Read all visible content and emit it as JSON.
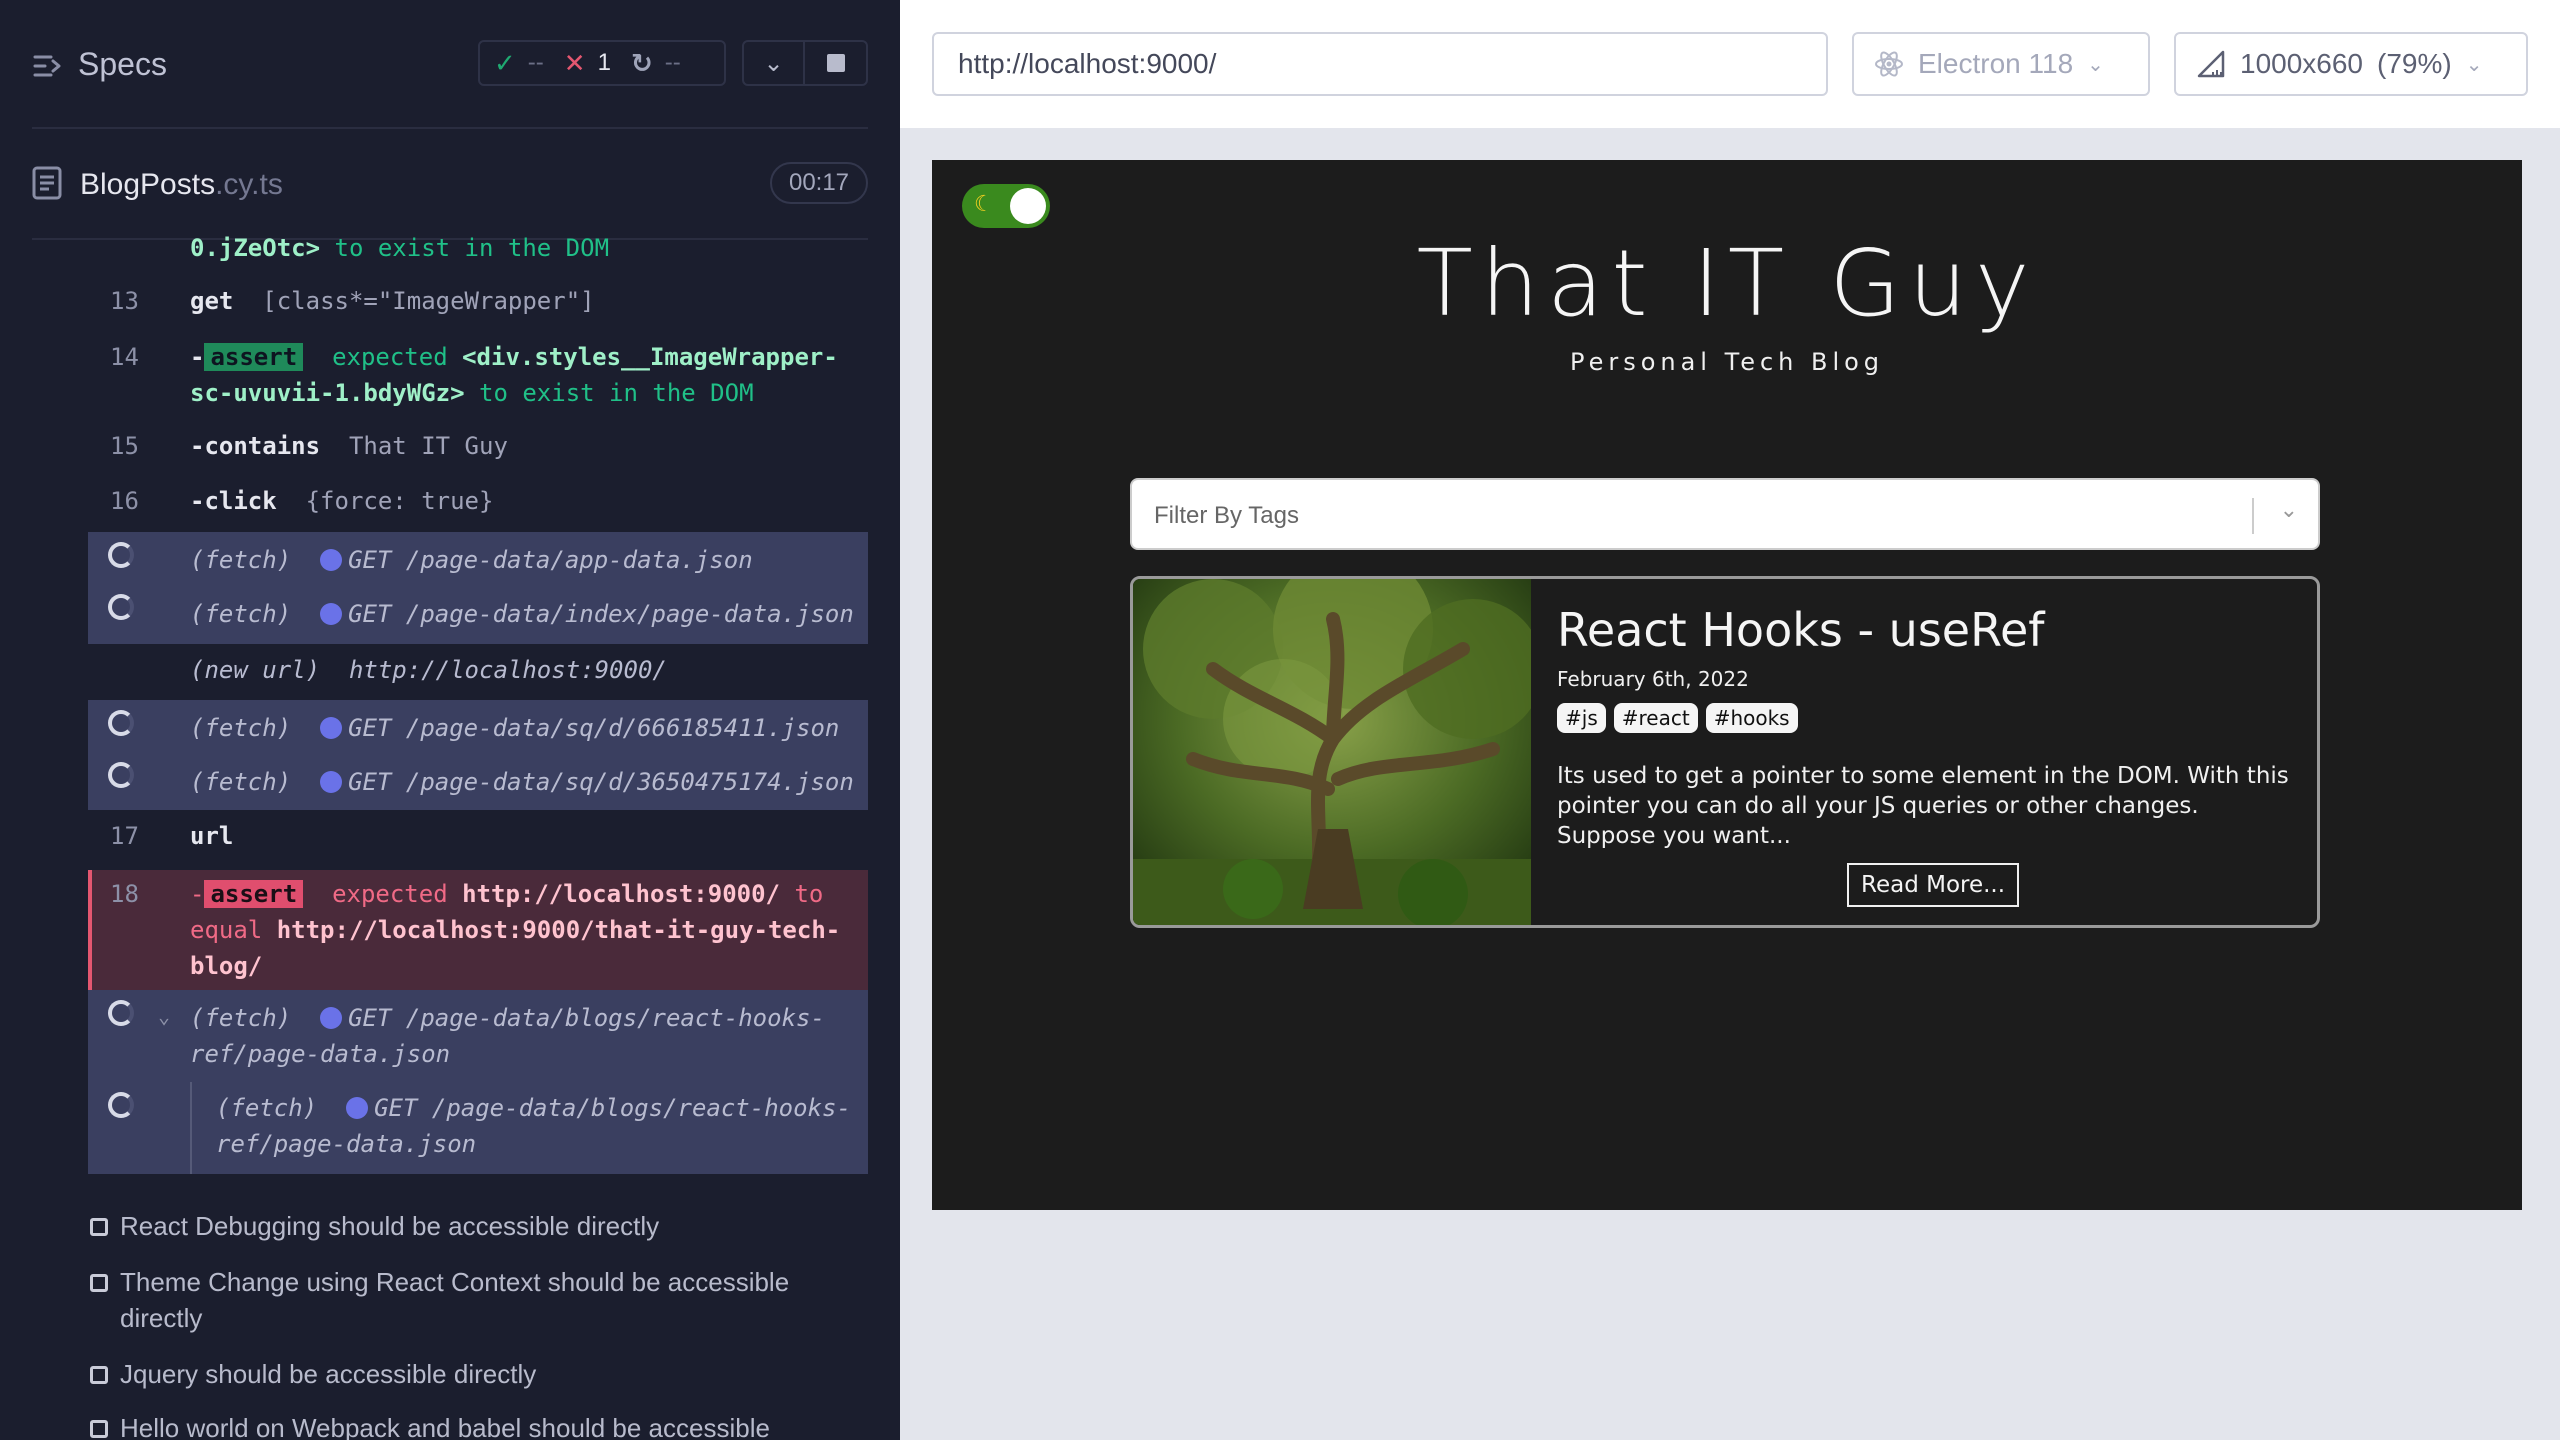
{
  "reporter": {
    "specs_label": "Specs",
    "stats": {
      "passed": "--",
      "failed": "1",
      "pending": "--"
    },
    "spec": {
      "name": "BlogPosts",
      "ext": ".cy.ts",
      "time": "00:17"
    },
    "commands": [
      {
        "text_a": "0.jZeOtc>",
        "text_b": " to exist in the DOM"
      },
      {
        "num": "13",
        "name": "get",
        "arg": "[class*=\"ImageWrapper\"]"
      },
      {
        "num": "14",
        "prefix": "-",
        "name": "assert",
        "l1a": "expected ",
        "l1b": "<div.styles__ImageWrapper-",
        "l2a": "sc-uvuvii-1.bdyWGz>",
        "l2b": " to exist in the DOM"
      },
      {
        "num": "15",
        "prefix": "-",
        "name": "contains",
        "arg": "That IT Guy"
      },
      {
        "num": "16",
        "prefix": "-",
        "name": "click",
        "arg": "{force: true}"
      },
      {
        "name": "(fetch)",
        "method": "GET",
        "path": "/page-data/app-data.json"
      },
      {
        "name": "(fetch)",
        "method": "GET",
        "path": "/page-data/index/page-data.json"
      },
      {
        "name": "(new url)",
        "arg": "http://localhost:9000/"
      },
      {
        "name": "(fetch)",
        "method": "GET",
        "path": "/page-data/sq/d/666185411.json"
      },
      {
        "name": "(fetch)",
        "method": "GET",
        "path": "/page-data/sq/d/3650475174.json"
      },
      {
        "num": "17",
        "name": "url"
      },
      {
        "num": "18",
        "prefix": "-",
        "name": "assert",
        "l1a": "expected ",
        "l1b": "http://localhost:9000/",
        "l1c": " to",
        "l2a": "equal ",
        "l2b": "http://localhost:9000/that-it-guy-tech-",
        "l3": "blog/"
      },
      {
        "name": "(fetch)",
        "method": "GET",
        "path1": "/page-data/blogs/react-hooks-",
        "path2": "ref/page-data.json"
      },
      {
        "name": "(fetch)",
        "method": "GET",
        "path1": "/page-data/blogs/react-hooks-",
        "path2": "ref/page-data.json"
      }
    ],
    "tests": [
      {
        "title": "React Debugging should be accessible directly"
      },
      {
        "title": "Theme Change using React Context should be accessible directly"
      },
      {
        "title": "Jquery should be accessible directly"
      },
      {
        "title": "Hello world on Webpack and babel should be accessible"
      }
    ]
  },
  "runner": {
    "url": "http://localhost:9000/",
    "browser": "Electron 118",
    "viewport": "1000x660",
    "zoom": "(79%)"
  },
  "aut": {
    "blog_title": "That IT Guy",
    "blog_subtitle": "Personal Tech Blog",
    "filter_placeholder": "Filter By Tags",
    "post": {
      "title": "React Hooks - useRef",
      "date": "February 6th, 2022",
      "tags": [
        "#js",
        "#react",
        "#hooks"
      ],
      "excerpt": "Its used to get a pointer to some element in the DOM. With this pointer you can do all your JS queries or other changes. Suppose you want...",
      "read_more": "Read More..."
    }
  },
  "colors": {
    "reporter_bg": "#1b1e2e",
    "pass": "#1fa971",
    "fail": "#e45770",
    "network_dot": "#6a72e8",
    "aut_bg": "#1c1c1c"
  }
}
